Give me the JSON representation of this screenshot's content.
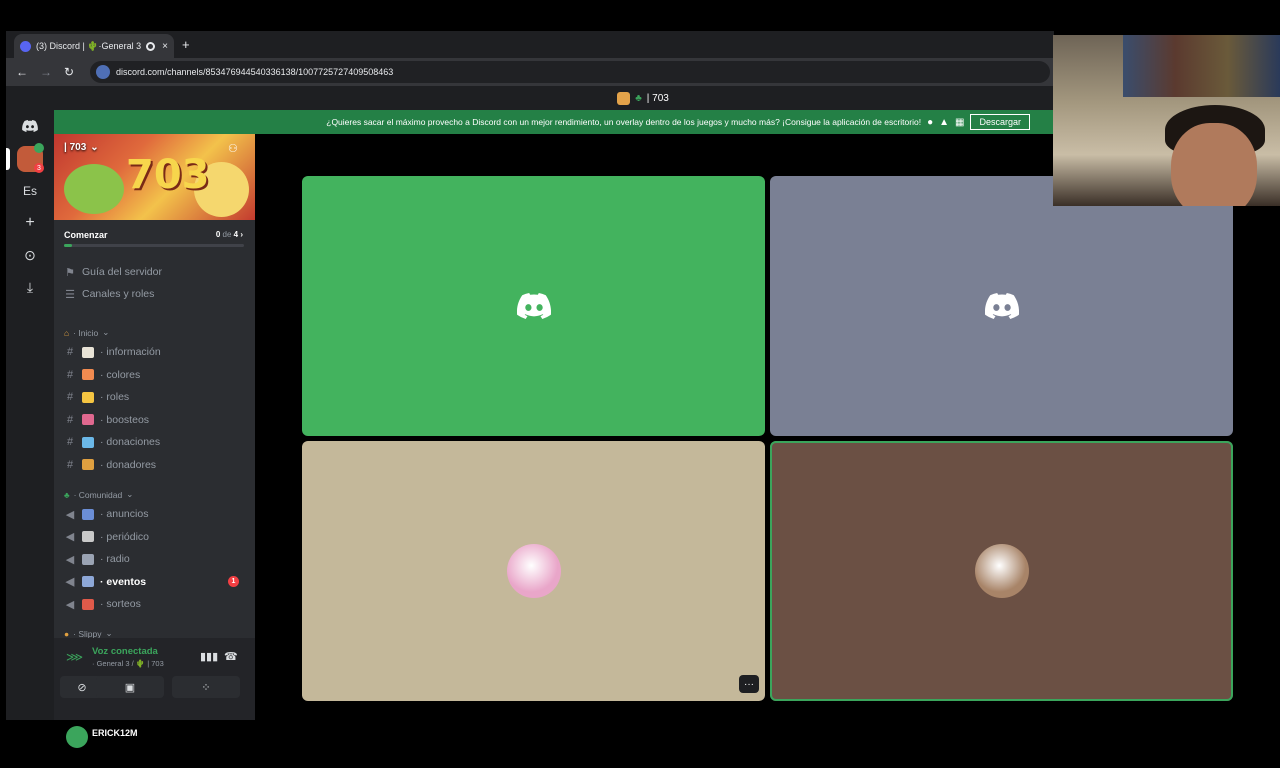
{
  "browser": {
    "tab_title": "(3) Discord | 🌵·General 3",
    "tab_close": "×",
    "new_tab": "+",
    "back": "←",
    "forward": "→",
    "reload": "↻",
    "url": "discord.com/channels/853476944540336138/1007725727409508463"
  },
  "app": {
    "window_title": "| 703",
    "banner": {
      "text": "¿Quieres sacar el máximo provecho a Discord con un mejor rendimiento, un overlay dentro de los juegos y mucho más? ¡Consigue la aplicación de escritorio!",
      "download_label": "Descargar"
    },
    "guilds": {
      "home_label": "",
      "server_badge_top": "",
      "server_badge_count": "3",
      "es_label": "Es",
      "add_label": "+",
      "discover_label": "⊙",
      "download_label": "⤓"
    },
    "server": {
      "name": "| 703",
      "banner_number": "703",
      "onboarding_label": "Comenzar",
      "onboarding_done": "0",
      "onboarding_of": "de",
      "onboarding_total": "4",
      "onboarding_progress": 0.0
    },
    "nav": [
      {
        "label": "Guía del servidor",
        "icon": "signpost-icon"
      },
      {
        "label": "Canales y roles",
        "icon": "list-icon"
      }
    ],
    "categories": {
      "inicio": "· Inicio",
      "comunidad": "· Comunidad",
      "slippy": "· Slippy"
    },
    "channels_inicio": [
      {
        "label": "información",
        "color": "#e8e3d6"
      },
      {
        "label": "colores",
        "color": "#f28b50"
      },
      {
        "label": "roles",
        "color": "#f5c542"
      },
      {
        "label": "boosteos",
        "color": "#e0688f"
      },
      {
        "label": "donaciones",
        "color": "#6bb8e8"
      },
      {
        "label": "donadores",
        "color": "#e0a040"
      }
    ],
    "channels_comunidad": [
      {
        "label": "anuncios",
        "color": "#6b8ed6"
      },
      {
        "label": "periódico",
        "color": "#c9c9c9"
      },
      {
        "label": "radio",
        "color": "#9aa3b3"
      },
      {
        "label": "eventos",
        "color": "#8ea8d8",
        "mention": "1"
      },
      {
        "label": "sorteos",
        "color": "#e05a4a"
      }
    ],
    "voice": {
      "status": "Voz conectada",
      "channel": "· General 3 / 🌵 | 703"
    },
    "user": {
      "name": "ERICK12M"
    },
    "tiles": [
      {
        "bg": "#43b35e",
        "type": "logo"
      },
      {
        "bg": "#7a8094",
        "type": "logo"
      },
      {
        "bg": "#c4b89a",
        "type": "avatar",
        "avatar_color": "#e9a6c9"
      },
      {
        "bg": "#6b5044",
        "type": "avatar",
        "avatar_color": "#a88468",
        "speaking": true
      }
    ],
    "more_label": "···"
  },
  "colors": {
    "accent_green": "#3ba55c",
    "mention_red": "#f23f43",
    "blurple": "#5865f2"
  }
}
